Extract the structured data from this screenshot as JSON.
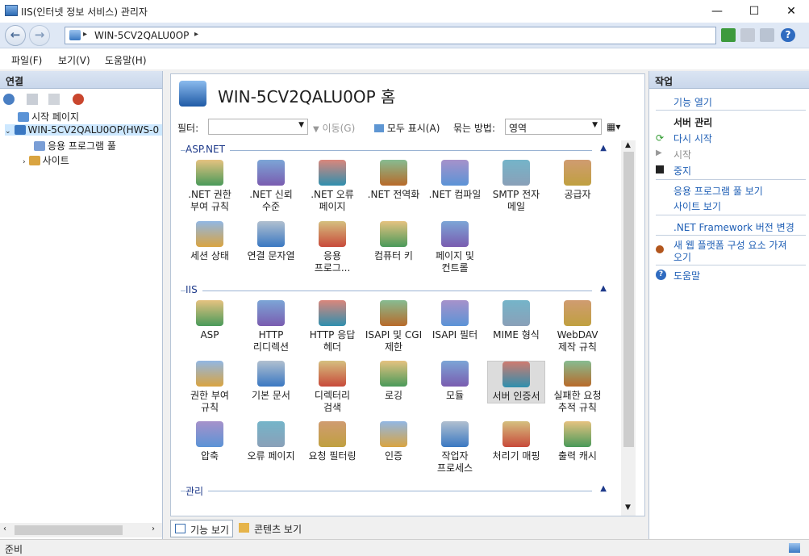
{
  "window": {
    "title": "IIS(인터넷 정보 서비스) 관리자",
    "minimize": "—",
    "maximize": "☐",
    "close": "✕"
  },
  "address": {
    "crumb": "WIN-5CV2QALU0OP",
    "sep1": "▸",
    "sep2": "▸"
  },
  "menu": {
    "file": "파일(F)",
    "view": "보기(V)",
    "help": "도움말(H)"
  },
  "connections": {
    "title": "연결",
    "tree": {
      "start": "시작 페이지",
      "server": "WIN-5CV2QALU0OP(HWS-0",
      "apppools": "응용 프로그램 풀",
      "sites": "사이트"
    }
  },
  "center": {
    "home_title": "WIN-5CV2QALU0OP 홈",
    "filter": {
      "label": "필터:",
      "go": "이동(G)",
      "show_all": "모두 표시(A)",
      "group_by_label": "묶는 방법:",
      "group_by_value": "영역"
    },
    "sections": {
      "aspnet": "ASP.NET",
      "iis": "IIS",
      "management": "관리"
    },
    "aspnet_items": [
      {
        "l1": ".NET 권한",
        "l2": "부여 규칙"
      },
      {
        "l1": ".NET 신뢰",
        "l2": "수준"
      },
      {
        "l1": ".NET 오류",
        "l2": "페이지"
      },
      {
        "l1": ".NET 전역화",
        "l2": ""
      },
      {
        "l1": ".NET 컴파일",
        "l2": ""
      },
      {
        "l1": "SMTP 전자",
        "l2": "메일"
      },
      {
        "l1": "공급자",
        "l2": ""
      },
      {
        "l1": "세션 상태",
        "l2": ""
      },
      {
        "l1": "연결 문자열",
        "l2": ""
      },
      {
        "l1": "응용",
        "l2": "프로그..."
      },
      {
        "l1": "컴퓨터 키",
        "l2": ""
      },
      {
        "l1": "페이지 및",
        "l2": "컨트롤"
      }
    ],
    "iis_items": [
      {
        "l1": "ASP",
        "l2": ""
      },
      {
        "l1": "HTTP",
        "l2": "리디렉션"
      },
      {
        "l1": "HTTP 응답",
        "l2": "헤더"
      },
      {
        "l1": "ISAPI 및 CGI",
        "l2": "제한"
      },
      {
        "l1": "ISAPI 필터",
        "l2": ""
      },
      {
        "l1": "MIME 형식",
        "l2": ""
      },
      {
        "l1": "WebDAV",
        "l2": "제작 규칙"
      },
      {
        "l1": "권한 부여",
        "l2": "규칙"
      },
      {
        "l1": "기본 문서",
        "l2": ""
      },
      {
        "l1": "디렉터리",
        "l2": "검색"
      },
      {
        "l1": "로깅",
        "l2": ""
      },
      {
        "l1": "모듈",
        "l2": ""
      },
      {
        "l1": "서버 인증서",
        "l2": ""
      },
      {
        "l1": "실패한 요청",
        "l2": "추적 규칙"
      },
      {
        "l1": "압축",
        "l2": ""
      },
      {
        "l1": "오류 페이지",
        "l2": ""
      },
      {
        "l1": "요청 필터링",
        "l2": ""
      },
      {
        "l1": "인증",
        "l2": ""
      },
      {
        "l1": "작업자",
        "l2": "프로세스"
      },
      {
        "l1": "처리기 매핑",
        "l2": ""
      },
      {
        "l1": "출력 캐시",
        "l2": ""
      }
    ],
    "view_tabs": {
      "features": "기능 보기",
      "content": "콘텐츠 보기"
    }
  },
  "actions": {
    "title": "작업",
    "open_feature": "기능 열기",
    "server_mgmt": "서버 관리",
    "restart": "다시 시작",
    "start": "시작",
    "stop": "중지",
    "view_pools": "응용 프로그램 풀 보기",
    "view_sites": "사이트 보기",
    "net_version": ".NET Framework 버전 변경",
    "get_components_1": "새 웹 플랫폼 구성 요소 가져",
    "get_components_2": "오기",
    "help": "도움말"
  },
  "status": {
    "text": "준비"
  },
  "colors": {
    "accent": "#1f5fb5",
    "selected": "#cde8ff"
  }
}
